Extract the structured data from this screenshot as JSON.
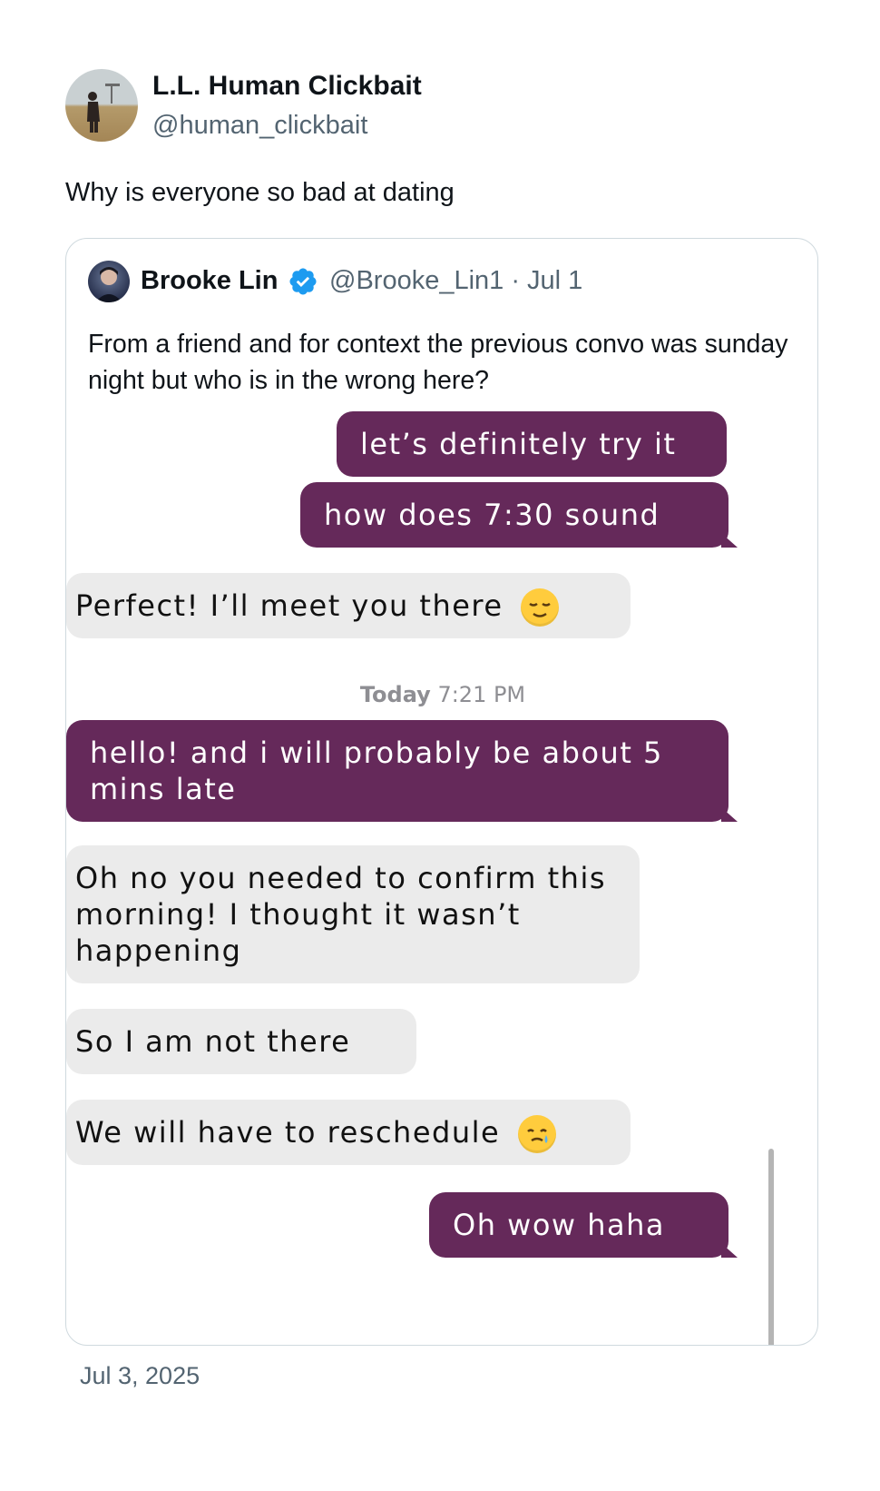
{
  "post": {
    "author_name": "L.L. Human Clickbait",
    "author_handle": "@human_clickbait",
    "text": "Why is everyone so bad at dating",
    "date": "Jul 3, 2025"
  },
  "quoted": {
    "author_name": "Brooke Lin",
    "author_handle_date": "@Brooke_Lin1 · Jul 1",
    "verified": true,
    "text": "From a friend and for context the previous convo was sunday night but who is in the wrong here?"
  },
  "chat": {
    "messages": [
      {
        "from": "me",
        "text": "let’s definitely try it"
      },
      {
        "from": "me",
        "text": "how does 7:30 sound"
      },
      {
        "from": "them",
        "text": "Perfect! I’ll meet you there",
        "emoji": "relieved-face"
      },
      {
        "from": "me",
        "text": "hello! and i will probably be about 5 mins late"
      },
      {
        "from": "them",
        "text": "Oh no you needed to confirm this morning! I thought it wasn’t happening"
      },
      {
        "from": "them",
        "text": "So I am not there"
      },
      {
        "from": "them",
        "text": "We will have to reschedule",
        "emoji": "smiling-face-with-tear"
      },
      {
        "from": "me",
        "text": "Oh wow haha"
      }
    ],
    "timestamp_day": "Today",
    "timestamp_time": "7:21 PM"
  },
  "colors": {
    "outgoing_bubble": "#65295a",
    "incoming_bubble": "#ebebeb",
    "verified_badge": "#1d9bf0"
  }
}
